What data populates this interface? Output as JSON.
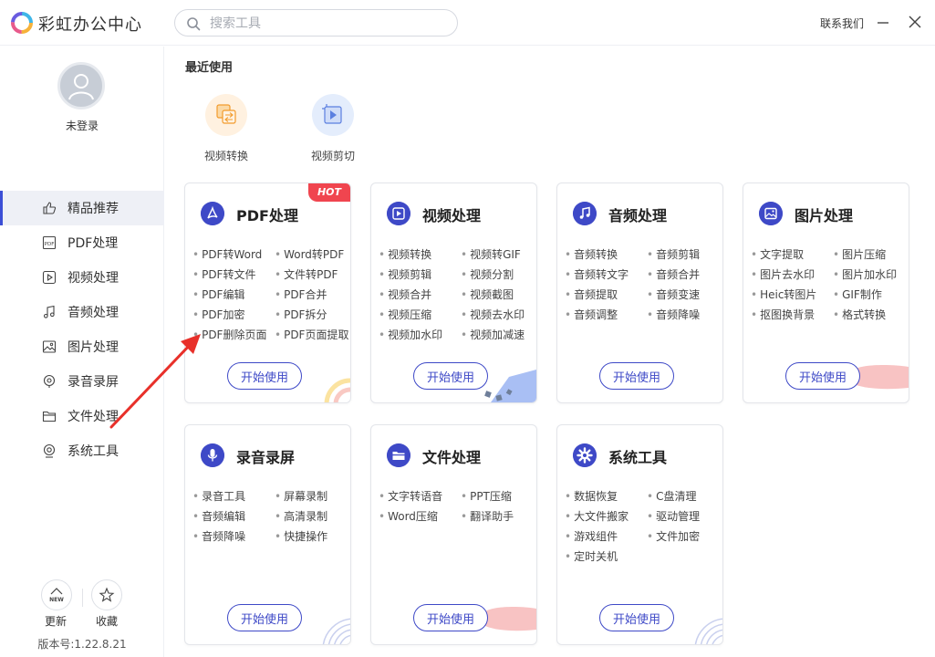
{
  "app": {
    "title": "彩虹办公中心"
  },
  "search": {
    "placeholder": "搜索工具"
  },
  "header": {
    "contact": "联系我们"
  },
  "user": {
    "login_label": "未登录"
  },
  "sidebar": {
    "items": [
      {
        "label": "精品推荐",
        "icon": "thumbs-up-icon",
        "active": true
      },
      {
        "label": "PDF处理",
        "icon": "pdf-icon"
      },
      {
        "label": "视频处理",
        "icon": "video-icon"
      },
      {
        "label": "音频处理",
        "icon": "music-note-icon"
      },
      {
        "label": "图片处理",
        "icon": "image-icon"
      },
      {
        "label": "录音录屏",
        "icon": "microphone-icon"
      },
      {
        "label": "文件处理",
        "icon": "folder-icon"
      },
      {
        "label": "系统工具",
        "icon": "system-tool-icon"
      }
    ],
    "update_label": "更新",
    "update_badge": "NEW",
    "favorite_label": "收藏",
    "version": "版本号:1.22.8.21"
  },
  "recent": {
    "title": "最近使用",
    "items": [
      {
        "label": "视频转换",
        "icon": "video-convert-icon"
      },
      {
        "label": "视频剪切",
        "icon": "video-cut-icon"
      }
    ]
  },
  "cards": [
    {
      "title": "PDF处理",
      "icon": "pdf-icon",
      "badge": "HOT",
      "items": [
        "PDF转Word",
        "Word转PDF",
        "PDF转文件",
        "文件转PDF",
        "PDF编辑",
        "PDF合并",
        "PDF加密",
        "PDF拆分",
        "PDF删除页面",
        "PDF页面提取"
      ]
    },
    {
      "title": "视频处理",
      "icon": "video-icon",
      "items": [
        "视频转换",
        "视频转GIF",
        "视频剪辑",
        "视频分割",
        "视频合并",
        "视频截图",
        "视频压缩",
        "视频去水印",
        "视频加水印",
        "视频加减速"
      ]
    },
    {
      "title": "音频处理",
      "icon": "music-note-icon",
      "items": [
        "音频转换",
        "音频剪辑",
        "音频转文字",
        "音频合并",
        "音频提取",
        "音频变速",
        "音频调整",
        "音频降噪"
      ]
    },
    {
      "title": "图片处理",
      "icon": "image-icon",
      "items": [
        "文字提取",
        "图片压缩",
        "图片去水印",
        "图片加水印",
        "Heic转图片",
        "GIF制作",
        "抠图换背景",
        "格式转换"
      ]
    },
    {
      "title": "录音录屏",
      "icon": "microphone-icon",
      "items": [
        "录音工具",
        "屏幕录制",
        "音频编辑",
        "高清录制",
        "音频降噪",
        "快捷操作"
      ]
    },
    {
      "title": "文件处理",
      "icon": "folder-icon",
      "items": [
        "文字转语音",
        "PPT压缩",
        "Word压缩",
        "翻译助手"
      ]
    },
    {
      "title": "系统工具",
      "icon": "gear-icon",
      "items": [
        "数据恢复",
        "C盘清理",
        "大文件搬家",
        "驱动管理",
        "游戏组件",
        "文件加密",
        "定时关机"
      ]
    }
  ],
  "start_label": "开始使用",
  "colors": {
    "accent": "#3e49c7",
    "hot": "#f0454f",
    "sidebar_active_bg": "#eef0f6"
  }
}
